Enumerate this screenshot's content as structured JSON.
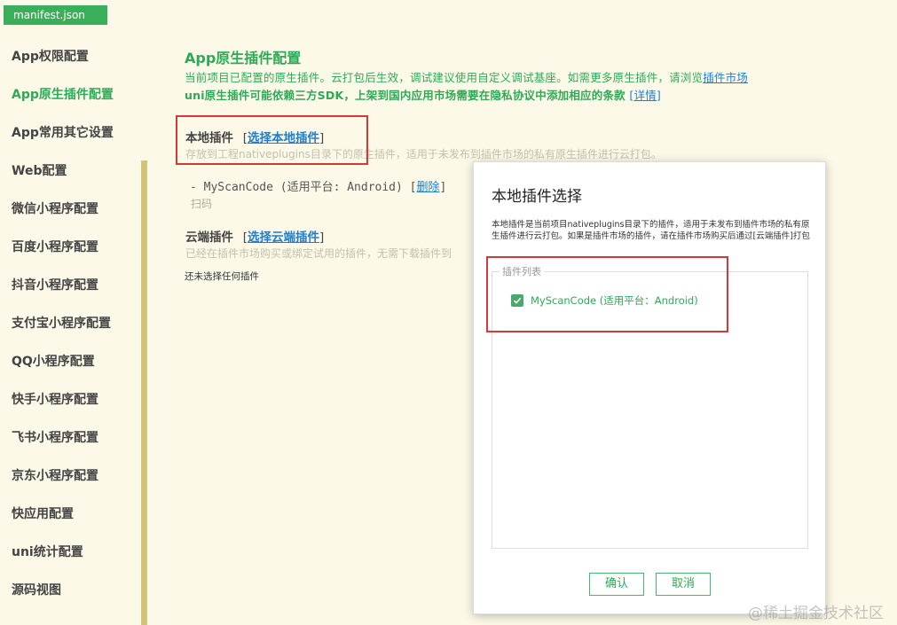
{
  "tab": {
    "title": "manifest.json"
  },
  "sidebar": {
    "items": [
      {
        "label": "App权限配置"
      },
      {
        "label": "App原生插件配置"
      },
      {
        "label": "App常用其它设置"
      },
      {
        "label": "Web配置"
      },
      {
        "label": "微信小程序配置"
      },
      {
        "label": "百度小程序配置"
      },
      {
        "label": "抖音小程序配置"
      },
      {
        "label": "支付宝小程序配置"
      },
      {
        "label": "QQ小程序配置"
      },
      {
        "label": "快手小程序配置"
      },
      {
        "label": "飞书小程序配置"
      },
      {
        "label": "京东小程序配置"
      },
      {
        "label": "快应用配置"
      },
      {
        "label": "uni统计配置"
      },
      {
        "label": "源码视图"
      }
    ]
  },
  "main": {
    "title": "App原生插件配置",
    "notice1": "当前项目已配置的原生插件。云打包后生效，调试建议使用自定义调试基座。如需更多原生插件，请浏览",
    "notice1_link": "插件市场",
    "notice2": "uni原生插件可能依赖三方SDK，上架到国内应用市场需要在隐私协议中添加相应的条款",
    "notice2_link": "[详情]",
    "local": {
      "label": "本地插件",
      "bracket_open": "[",
      "link": "选择本地插件",
      "bracket_close": "]",
      "desc": "存放到工程nativeplugins目录下的原生插件，适用于未发布到插件市场的私有原生插件进行云打包。",
      "plugin_text": "- MyScanCode (适用平台: Android) [",
      "plugin_delete": "删除",
      "plugin_close": "]",
      "plugin_sub": "扫码"
    },
    "cloud": {
      "label": "云端插件",
      "bracket_open": "[",
      "link": "选择云端插件",
      "bracket_close": "]",
      "desc": "已经在插件市场购买或绑定试用的插件，无需下载插件到",
      "none": "还未选择任何插件"
    }
  },
  "dialog": {
    "title": "本地插件选择",
    "desc": "本地插件是当前项目nativeplugins目录下的插件，适用于未发布到插件市场的私有原生插件进行云打包。如果是插件市场的插件，请在插件市场购买后通过[云端插件]打包",
    "legend": "插件列表",
    "plugin_label": "MyScanCode (适用平台：Android)",
    "plugin_checked": true,
    "confirm": "确认",
    "cancel": "取消"
  },
  "watermark": "@稀土掘金技术社区",
  "colors": {
    "accent": "#2eaa56",
    "link": "#1a7fd4",
    "highlight_box": "#d23a3a",
    "background": "#fcf9e8"
  }
}
